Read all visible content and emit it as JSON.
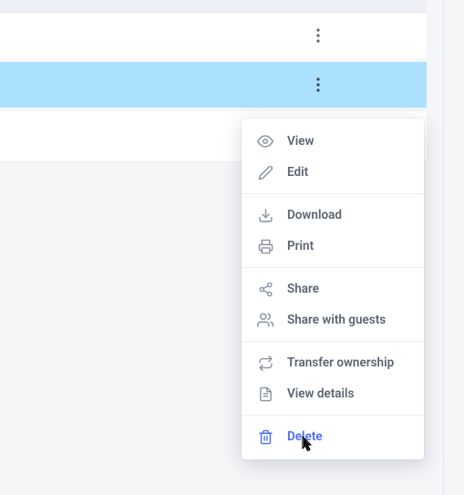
{
  "menu": {
    "view": "View",
    "edit": "Edit",
    "download": "Download",
    "print": "Print",
    "share": "Share",
    "share_guests": "Share with guests",
    "transfer": "Transfer ownership",
    "details": "View details",
    "delete": "Delete"
  }
}
